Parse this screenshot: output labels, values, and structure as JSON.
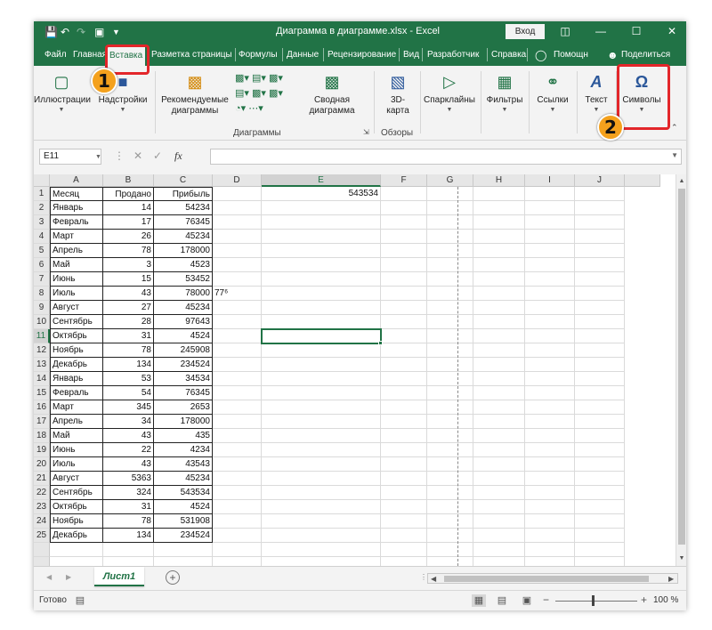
{
  "window": {
    "title": "Диаграмма в диаграмме.xlsx  -  Excel",
    "signin_label": "Вход",
    "accent": "#217346"
  },
  "tabs": [
    "Файл",
    "Главная",
    "Вставка",
    "Разметка страницы",
    "Формулы",
    "Данные",
    "Рецензирование",
    "Вид",
    "Разработчик",
    "Справка",
    "Помощн",
    "Поделиться"
  ],
  "active_tab": "Вставка",
  "ribbon": {
    "groups": [
      {
        "label": "Иллюстрации",
        "icon": "illustrations-icon"
      },
      {
        "label": "Надстройки",
        "icon": "addins-icon"
      },
      {
        "label": "Рекомендуемые\nдиаграммы",
        "icon": "recommended-charts-icon"
      },
      {
        "label": "Сводная\nдиаграмма",
        "icon": "pivot-chart-icon"
      },
      {
        "label": "3D-\nкарта",
        "icon": "3d-map-icon"
      },
      {
        "label": "Спарклайны",
        "icon": "sparklines-icon"
      },
      {
        "label": "Фильтры",
        "icon": "filters-icon"
      },
      {
        "label": "Ссылки",
        "icon": "links-icon"
      },
      {
        "label": "Текст",
        "icon": "text-icon"
      },
      {
        "label": "Символы",
        "icon": "omega-icon"
      }
    ],
    "group_labels": {
      "charts": "Диаграммы",
      "tours": "Обзоры"
    }
  },
  "formula_bar": {
    "name_box": "E11",
    "formula": ""
  },
  "columns": [
    "A",
    "B",
    "C",
    "D",
    "E",
    "F",
    "G",
    "H",
    "I",
    "J"
  ],
  "selected_cell": {
    "col": "E",
    "row": 11
  },
  "rows": [
    {
      "n": "1",
      "a": "Месяц",
      "b": "Продано",
      "c": "Прибыль",
      "e": "543534"
    },
    {
      "n": "2",
      "a": "Январь",
      "b": "14",
      "c": "54234"
    },
    {
      "n": "3",
      "a": "Февраль",
      "b": "17",
      "c": "76345"
    },
    {
      "n": "4",
      "a": "Март",
      "b": "26",
      "c": "45234"
    },
    {
      "n": "5",
      "a": "Апрель",
      "b": "78",
      "c": "178000"
    },
    {
      "n": "6",
      "a": "Май",
      "b": "3",
      "c": "4523"
    },
    {
      "n": "7",
      "a": "Июнь",
      "b": "15",
      "c": "53452"
    },
    {
      "n": "8",
      "a": "Июль",
      "b": "43",
      "c": "78000",
      "d": "77⁶"
    },
    {
      "n": "9",
      "a": "Август",
      "b": "27",
      "c": "45234"
    },
    {
      "n": "10",
      "a": "Сентябрь",
      "b": "28",
      "c": "97643"
    },
    {
      "n": "11",
      "a": "Октябрь",
      "b": "31",
      "c": "4524"
    },
    {
      "n": "12",
      "a": "Ноябрь",
      "b": "78",
      "c": "245908"
    },
    {
      "n": "13",
      "a": "Декабрь",
      "b": "134",
      "c": "234524"
    },
    {
      "n": "14",
      "a": "Январь",
      "b": "53",
      "c": "34534"
    },
    {
      "n": "15",
      "a": "Февраль",
      "b": "54",
      "c": "76345"
    },
    {
      "n": "16",
      "a": "Март",
      "b": "345",
      "c": "2653"
    },
    {
      "n": "17",
      "a": "Апрель",
      "b": "34",
      "c": "178000"
    },
    {
      "n": "18",
      "a": "Май",
      "b": "43",
      "c": "435"
    },
    {
      "n": "19",
      "a": "Июнь",
      "b": "22",
      "c": "4234"
    },
    {
      "n": "20",
      "a": "Июль",
      "b": "43",
      "c": "43543"
    },
    {
      "n": "21",
      "a": "Август",
      "b": "5363",
      "c": "45234"
    },
    {
      "n": "22",
      "a": "Сентябрь",
      "b": "324",
      "c": "543534"
    },
    {
      "n": "23",
      "a": "Октябрь",
      "b": "31",
      "c": "4524"
    },
    {
      "n": "24",
      "a": "Ноябрь",
      "b": "78",
      "c": "531908"
    },
    {
      "n": "25",
      "a": "Декабрь",
      "b": "134",
      "c": "234524"
    }
  ],
  "sheet_tab": "Лист1",
  "status": {
    "ready": "Готово",
    "zoom": "100 %"
  },
  "annotations": {
    "step1": "1",
    "step2": "2",
    "highlight_color": "#e3262a",
    "badge_color": "#f4a11d"
  }
}
